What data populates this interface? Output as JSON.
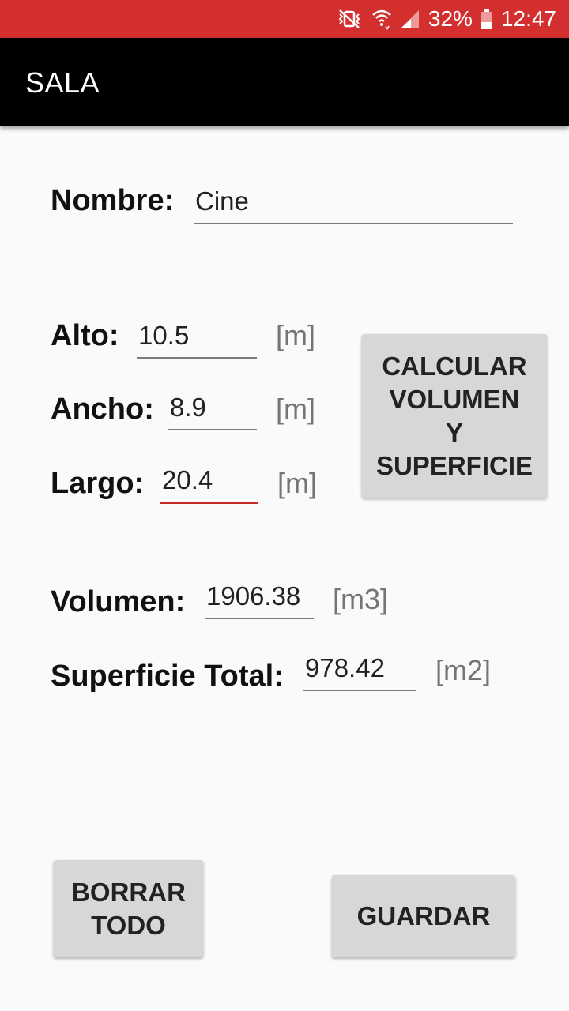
{
  "status_bar": {
    "battery": "32%",
    "time": "12:47",
    "icons": [
      "vibrate-mute-icon",
      "wifi-icon",
      "signal-icon",
      "battery-icon"
    ]
  },
  "app_bar": {
    "title": "SALA"
  },
  "form": {
    "nombre": {
      "label": "Nombre:",
      "value": "Cine"
    },
    "alto": {
      "label": "Alto:",
      "value": "10.5",
      "unit": "[m]"
    },
    "ancho": {
      "label": "Ancho:",
      "value": "8.9",
      "unit": "[m]"
    },
    "largo": {
      "label": "Largo:",
      "value": "20.4",
      "unit": "[m]"
    },
    "volumen": {
      "label": "Volumen:",
      "value": "1906.38",
      "unit": "[m3]"
    },
    "superficie": {
      "label": "Superficie Total:",
      "value": "978.42",
      "unit": "[m2]"
    }
  },
  "buttons": {
    "calcular": "CALCULAR\nVOLUMEN\nY\nSUPERFICIE",
    "borrar": "BORRAR\nTODO",
    "guardar": "GUARDAR"
  },
  "colors": {
    "status_bar": "#d32f2f",
    "app_bar": "#000000",
    "accent": "#c62828",
    "button": "#d6d7d7"
  }
}
